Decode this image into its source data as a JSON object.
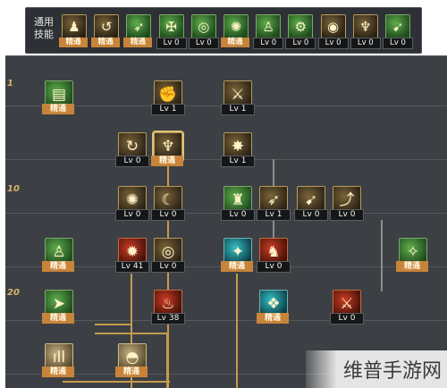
{
  "common_bar": {
    "label": "通用\n技能",
    "skills": [
      {
        "name": "common-skill-1",
        "icon": "figure-pose",
        "color": "gold",
        "status": "精通",
        "kind": "master"
      },
      {
        "name": "common-skill-2",
        "icon": "crouch-spin",
        "color": "gold",
        "status": "精通",
        "kind": "master"
      },
      {
        "name": "common-skill-3",
        "icon": "runner",
        "color": "green",
        "status": "精通",
        "kind": "master"
      },
      {
        "name": "common-skill-4",
        "icon": "winged-emblem",
        "color": "green",
        "status": "Lv 0",
        "kind": "lv"
      },
      {
        "name": "common-skill-5",
        "icon": "target-reticle",
        "color": "green",
        "status": "Lv 0",
        "kind": "lv"
      },
      {
        "name": "common-skill-6",
        "icon": "target-burst",
        "color": "green",
        "status": "精通",
        "kind": "master"
      },
      {
        "name": "common-skill-7",
        "icon": "kneeling-figure",
        "color": "green",
        "status": "Lv 0",
        "kind": "lv"
      },
      {
        "name": "common-skill-8",
        "icon": "figure-gear",
        "color": "green",
        "status": "Lv 0",
        "kind": "lv"
      },
      {
        "name": "common-skill-9",
        "icon": "vortex",
        "color": "gold",
        "status": "Lv 0",
        "kind": "lv"
      },
      {
        "name": "common-skill-10",
        "icon": "flexing-figure",
        "color": "gold",
        "status": "Lv 0",
        "kind": "lv"
      },
      {
        "name": "common-skill-11",
        "icon": "leaping-figure",
        "color": "green",
        "status": "Lv 0",
        "kind": "lv"
      }
    ]
  },
  "tree": {
    "levels": [
      {
        "label": "1",
        "row": 0
      },
      {
        "label": "10",
        "row": 2
      },
      {
        "label": "20",
        "row": 4
      }
    ],
    "skills": [
      {
        "name": "skill-book-scroll",
        "icon": "scroll",
        "glyph": "▤",
        "color": "green",
        "status": "精通",
        "kind": "master",
        "row": 0,
        "col": 0
      },
      {
        "name": "skill-upper-cut",
        "icon": "fist",
        "glyph": "✊",
        "color": "gold",
        "status": "Lv 1",
        "kind": "lv",
        "row": 0,
        "col": 2
      },
      {
        "name": "skill-blade-slash",
        "icon": "blade",
        "glyph": "⚔",
        "color": "gold",
        "status": "Lv 1",
        "kind": "lv",
        "row": 0,
        "col": 3
      },
      {
        "name": "skill-spin-kick",
        "icon": "spin",
        "glyph": "↻",
        "color": "gold",
        "status": "Lv 0",
        "kind": "lv",
        "row": 1,
        "col": 1
      },
      {
        "name": "skill-power-stance",
        "icon": "warrior",
        "glyph": "♆",
        "color": "gold",
        "status": "精通",
        "kind": "master",
        "row": 1,
        "col": 2,
        "selected": true
      },
      {
        "name": "skill-ground-slam",
        "icon": "impact",
        "glyph": "✸",
        "color": "gold",
        "status": "Lv 1",
        "kind": "lv",
        "row": 1,
        "col": 3
      },
      {
        "name": "skill-whirlwind",
        "icon": "whirl",
        "glyph": "✺",
        "color": "gold",
        "status": "Lv 0",
        "kind": "lv",
        "row": 2,
        "col": 1
      },
      {
        "name": "skill-crescent",
        "icon": "crescent",
        "glyph": "☾",
        "color": "gold",
        "status": "Lv 0",
        "kind": "lv",
        "row": 2,
        "col": 2
      },
      {
        "name": "skill-guard-stance",
        "icon": "guard",
        "glyph": "♜",
        "color": "green",
        "status": "Lv 0",
        "kind": "lv",
        "row": 2,
        "col": 3
      },
      {
        "name": "skill-lunge",
        "icon": "lunge",
        "glyph": "➶",
        "color": "gold",
        "status": "Lv 1",
        "kind": "lv",
        "row": 2,
        "col": 4
      },
      {
        "name": "skill-dash-strike",
        "icon": "dash",
        "glyph": "➹",
        "color": "gold",
        "status": "Lv 0",
        "kind": "lv",
        "row": 2,
        "col": 5
      },
      {
        "name": "skill-rising-blow",
        "icon": "rising",
        "glyph": "⤴",
        "color": "gold",
        "status": "Lv 0",
        "kind": "lv",
        "row": 2,
        "col": 6
      },
      {
        "name": "skill-body-harden",
        "icon": "body",
        "glyph": "♙",
        "color": "green",
        "status": "精通",
        "kind": "master",
        "row": 3,
        "col": 0
      },
      {
        "name": "skill-fire-burst",
        "icon": "fire",
        "glyph": "✹",
        "color": "red",
        "status": "Lv 41",
        "kind": "lv",
        "row": 3,
        "col": 1
      },
      {
        "name": "skill-vortex",
        "icon": "vortex",
        "glyph": "◎",
        "color": "gold",
        "status": "Lv 0",
        "kind": "lv",
        "row": 3,
        "col": 2
      },
      {
        "name": "skill-star-flash",
        "icon": "star",
        "glyph": "✦",
        "color": "cyan",
        "status": "精通",
        "kind": "master",
        "row": 3,
        "col": 3
      },
      {
        "name": "skill-berserk",
        "icon": "berserk",
        "glyph": "♞",
        "color": "red",
        "status": "Lv 0",
        "kind": "lv",
        "row": 3,
        "col": 4
      },
      {
        "name": "skill-spark",
        "icon": "spark",
        "glyph": "✧",
        "color": "green",
        "status": "精通",
        "kind": "master",
        "row": 3,
        "col": 7
      },
      {
        "name": "skill-arrow-charge",
        "icon": "arrow",
        "glyph": "➤",
        "color": "green",
        "status": "精通",
        "kind": "master",
        "row": 4,
        "col": 0
      },
      {
        "name": "skill-rage",
        "icon": "rage",
        "glyph": "♨",
        "color": "red",
        "status": "Lv 38",
        "kind": "lv",
        "row": 4,
        "col": 2
      },
      {
        "name": "skill-shatter",
        "icon": "shatter",
        "glyph": "❖",
        "color": "cyan",
        "status": "精通",
        "kind": "master",
        "row": 4,
        "col": 4
      },
      {
        "name": "skill-crimson-blade",
        "icon": "blade",
        "glyph": "⚔",
        "color": "red",
        "status": "Lv 0",
        "kind": "lv",
        "row": 4,
        "col": 6
      },
      {
        "name": "skill-sound-wave",
        "icon": "wave",
        "glyph": "ıll",
        "color": "tan",
        "status": "精通",
        "kind": "master",
        "row": 5,
        "col": 0
      },
      {
        "name": "skill-shield-dome",
        "icon": "dome",
        "glyph": "◓",
        "color": "tan",
        "status": "精通",
        "kind": "master",
        "row": 5,
        "col": 1
      }
    ]
  },
  "watermark": "维普手游网"
}
